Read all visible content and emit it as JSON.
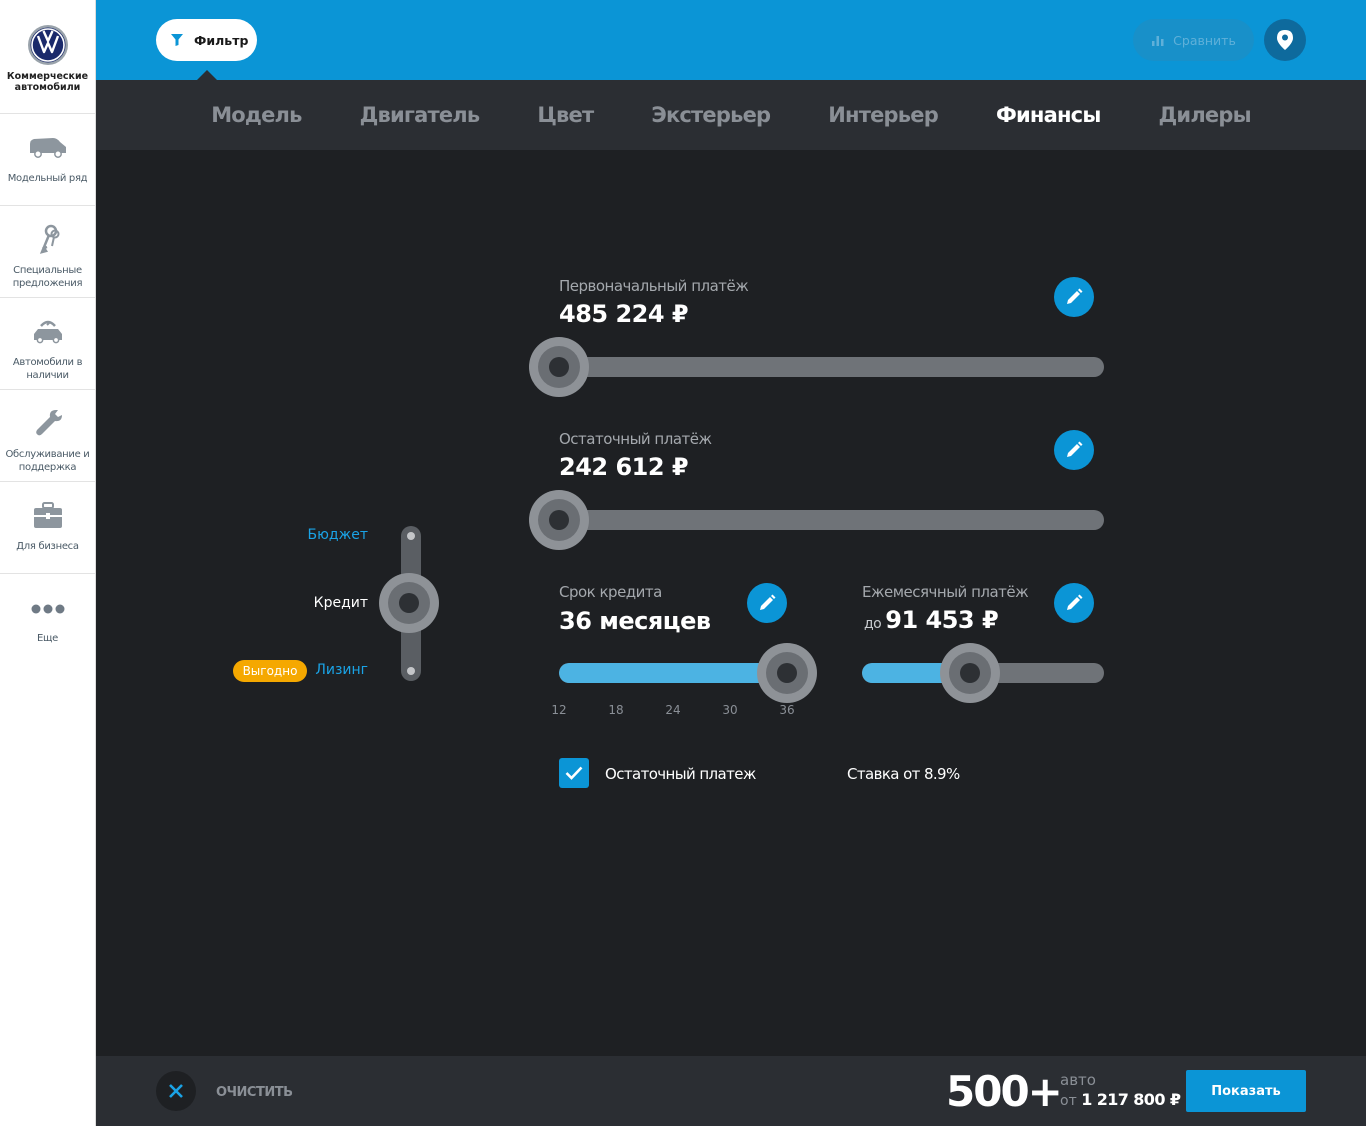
{
  "sidebar": {
    "brand": "Коммерческие автомобили",
    "items": [
      {
        "label": "Модельный ряд",
        "icon": "van-icon"
      },
      {
        "label": "Специальные предложения",
        "icon": "keys-icon"
      },
      {
        "label": "Автомобили в наличии",
        "icon": "car-stock-icon"
      },
      {
        "label": "Обслуживание и поддержка",
        "icon": "wrench-icon"
      },
      {
        "label": "Для бизнеса",
        "icon": "briefcase-icon"
      },
      {
        "label": "Еще",
        "icon": "more-dots-icon"
      }
    ]
  },
  "header": {
    "filter_label": "Фильтр",
    "compare_label": "Сравнить"
  },
  "tabs": [
    {
      "label": "Модель"
    },
    {
      "label": "Двигатель"
    },
    {
      "label": "Цвет"
    },
    {
      "label": "Экстерьер"
    },
    {
      "label": "Интерьер"
    },
    {
      "label": "Финансы",
      "active": true
    },
    {
      "label": "Дилеры"
    }
  ],
  "finance_type": {
    "options": [
      "Бюджет",
      "Кредит",
      "Лизинг"
    ],
    "selected": "Кредит",
    "badge": "Выгодно"
  },
  "finance": {
    "down_payment": {
      "label": "Первоначальный платёж",
      "value": "485 224 ₽",
      "position": 0.0
    },
    "residual_payment": {
      "label": "Остаточный платёж",
      "value": "242 612 ₽",
      "position": 0.0
    },
    "term": {
      "label": "Срок кредита",
      "value": "36 месяцев",
      "ticks": [
        "12",
        "18",
        "24",
        "30",
        "36"
      ],
      "position": 1.0
    },
    "monthly": {
      "label": "Ежемесячный платёж",
      "prefix": "до",
      "value": "91 453 ₽",
      "position": 0.43
    },
    "residual_checkbox": {
      "label": "Остаточный платеж",
      "checked": true
    },
    "rate": "Ставка от 8.9%"
  },
  "footer": {
    "clear_label": "ОЧИСТИТЬ",
    "count": "500+",
    "unit": "авто",
    "price_prefix": "от",
    "price": "1 217 800 ₽",
    "show_label": "Показать"
  },
  "colors": {
    "accent": "#0b95d6",
    "background": "#1e2023",
    "badge": "#f5a800"
  }
}
